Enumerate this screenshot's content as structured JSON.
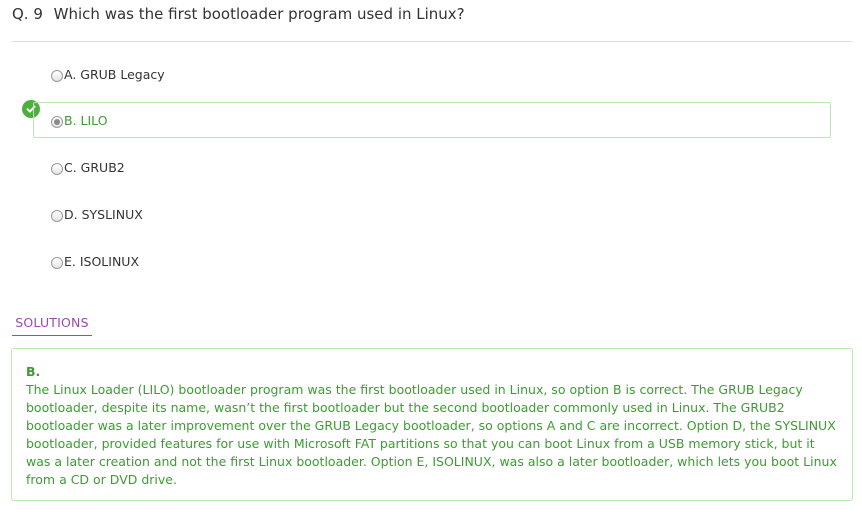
{
  "question": {
    "number": "Q. 9",
    "text": "Which was the first bootloader program used in Linux?"
  },
  "options": [
    {
      "label": "A. GRUB Legacy",
      "selected": false,
      "correct": false
    },
    {
      "label": "B. LILO",
      "selected": true,
      "correct": true
    },
    {
      "label": "C. GRUB2",
      "selected": false,
      "correct": false
    },
    {
      "label": "D. SYSLINUX",
      "selected": false,
      "correct": false
    },
    {
      "label": "E. ISOLINUX",
      "selected": false,
      "correct": false
    }
  ],
  "icons": {
    "correct_marker": "check-circle-icon"
  },
  "solutions": {
    "tab_label": "SOLUTIONS",
    "answer": "B.",
    "explanation": "The Linux Loader (LILO) bootloader program was the first bootloader used in Linux, so option B is correct. The GRUB Legacy bootloader, despite its name, wasn’t the first bootloader but the second bootloader commonly used in Linux. The GRUB2 bootloader was a later improvement over the GRUB Legacy bootloader, so options A and C are incorrect. Option D, the SYSLINUX bootloader, provided features for use with Microsoft FAT partitions so that you can boot Linux from a USB memory stick, but it was a later creation and not the first Linux bootloader. Option E, ISOLINUX, was also a later bootloader, which lets you boot Linux from a CD or DVD drive."
  },
  "colors": {
    "correct_green": "#3e9b34",
    "correct_border": "#b8e8b0",
    "tab_purple": "#9b4ab0"
  }
}
